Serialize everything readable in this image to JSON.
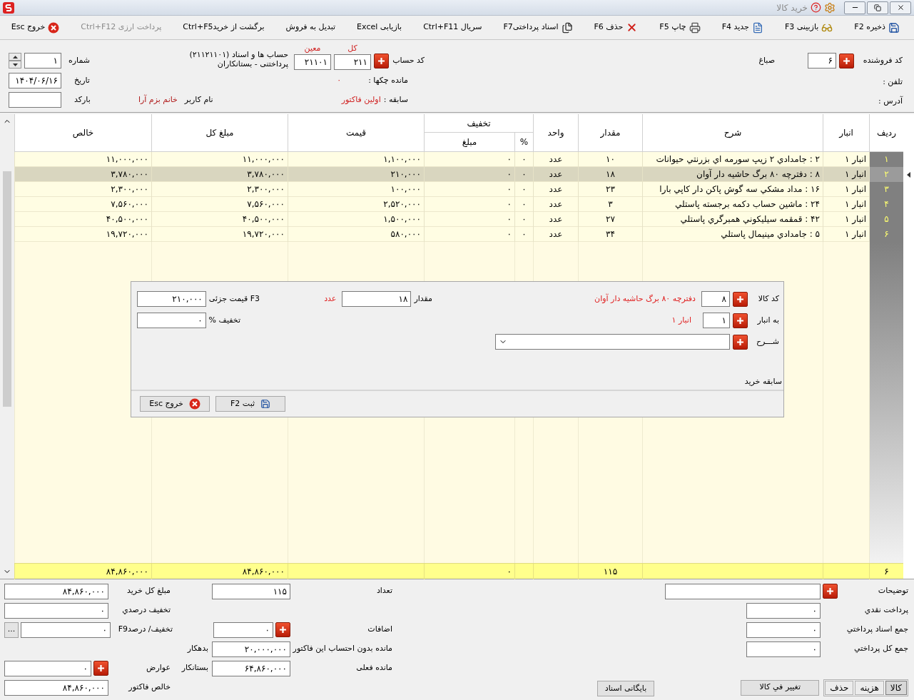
{
  "window": {
    "title": "خرید کالا"
  },
  "toolbar": [
    {
      "label": "ذخیره F2",
      "kind": "save",
      "disabled": false
    },
    {
      "label": "بازبینی F3",
      "kind": "review",
      "disabled": false
    },
    {
      "label": "جدید F4",
      "kind": "new",
      "disabled": false
    },
    {
      "label": "چاپ F5",
      "kind": "print",
      "disabled": false
    },
    {
      "label": "حذف F6",
      "kind": "delete",
      "disabled": false
    },
    {
      "label": "اسناد پرداختیF7",
      "kind": "docs",
      "disabled": false
    },
    {
      "label": "سریال Ctrl+F11",
      "kind": "text",
      "disabled": false
    },
    {
      "label": "بازیابی Excel",
      "kind": "text",
      "disabled": false
    },
    {
      "label": "تبدیل به فروش",
      "kind": "text",
      "disabled": false
    },
    {
      "label": "برگشت از خریدCtrl+F5",
      "kind": "text",
      "disabled": false
    },
    {
      "label": "پرداخت ارزی Ctrl+F12",
      "kind": "text",
      "disabled": true
    },
    {
      "label": "خروج Esc",
      "kind": "exit",
      "disabled": false
    }
  ],
  "header": {
    "vendor": {
      "label": "کد فروشنده",
      "value": "۶",
      "name": "صباغ"
    },
    "phone_label": "تلفن :",
    "address_label": "آدرس :",
    "account": {
      "label": "کد حساب",
      "total_label": "کل",
      "total": "۲۱۱",
      "sub_label": "معین",
      "sub": "۲۱۱۰۱",
      "title": "حساب ها و اسناد (۲۱۱۲۱۱۰۱)",
      "subtitle": "پرداختنی - بستانکاران"
    },
    "cheque_balance": {
      "label": "مانده چکها :",
      "value": "۰"
    },
    "history": {
      "label": "سابقه :",
      "value": "اولین فاکتور"
    },
    "user": {
      "label": "نام کاربر",
      "value": "خانم بزم آرا"
    },
    "number": {
      "label": "شماره",
      "value": "۱"
    },
    "date": {
      "label": "تاریخ",
      "value": "۱۴۰۴/۰۶/۱۶"
    },
    "barcode": {
      "label": "بارکد"
    }
  },
  "table": {
    "columns": [
      {
        "label": "ردیف"
      },
      {
        "label": "انبار"
      },
      {
        "label": "شرح"
      },
      {
        "label": "مقدار"
      },
      {
        "label": "واحد"
      },
      {
        "label": "تخفیف",
        "children": [
          {
            "label": "%"
          },
          {
            "label": "مبلغ"
          }
        ]
      },
      {
        "label": "قیمت"
      },
      {
        "label": "مبلغ کل"
      },
      {
        "label": "خالص"
      }
    ],
    "rows": [
      {
        "row": "۱",
        "warehouse": "انبار ۱",
        "description": "۲ : جامدادي ۲ زيپ سورمه اي بزرنتي حيوانات",
        "qty": "۱۰",
        "unit": "عدد",
        "percent": "۰",
        "discount": "۰",
        "price": "۱,۱۰۰,۰۰۰",
        "total": "۱۱,۰۰۰,۰۰۰",
        "net": "۱۱,۰۰۰,۰۰۰",
        "selected": false
      },
      {
        "row": "۲",
        "warehouse": "انبار ۱",
        "description": "۸ : دفترچه ۸۰ برگ حاشيه دار آوان",
        "qty": "۱۸",
        "unit": "عدد",
        "percent": "۰",
        "discount": "۰",
        "price": "۲۱۰,۰۰۰",
        "total": "۳,۷۸۰,۰۰۰",
        "net": "۳,۷۸۰,۰۰۰",
        "selected": true
      },
      {
        "row": "۳",
        "warehouse": "انبار ۱",
        "description": "۱۶ : مداد مشکي سه گوش پاکن دار کاپي بارا",
        "qty": "۲۳",
        "unit": "عدد",
        "percent": "۰",
        "discount": "۰",
        "price": "۱۰۰,۰۰۰",
        "total": "۲,۳۰۰,۰۰۰",
        "net": "۲,۳۰۰,۰۰۰",
        "selected": false
      },
      {
        "row": "۴",
        "warehouse": "انبار ۱",
        "description": "۲۴ : ماشين حساب دکمه برجسته پاستلي",
        "qty": "۳",
        "unit": "عدد",
        "percent": "۰",
        "discount": "۰",
        "price": "۲,۵۲۰,۰۰۰",
        "total": "۷,۵۶۰,۰۰۰",
        "net": "۷,۵۶۰,۰۰۰",
        "selected": false
      },
      {
        "row": "۵",
        "warehouse": "انبار ۱",
        "description": "۴۲ : قمقمه سيليکوني همبرگري پاستلي",
        "qty": "۲۷",
        "unit": "عدد",
        "percent": "۰",
        "discount": "۰",
        "price": "۱,۵۰۰,۰۰۰",
        "total": "۴۰,۵۰۰,۰۰۰",
        "net": "۴۰,۵۰۰,۰۰۰",
        "selected": false
      },
      {
        "row": "۶",
        "warehouse": "انبار ۱",
        "description": "۵ : جامدادي مينيمال پاستلي",
        "qty": "۳۴",
        "unit": "عدد",
        "percent": "۰",
        "discount": "۰",
        "price": "۵۸۰,۰۰۰",
        "total": "۱۹,۷۲۰,۰۰۰",
        "net": "۱۹,۷۲۰,۰۰۰",
        "selected": false
      }
    ],
    "totals": {
      "row": "۶",
      "qty": "۱۱۵",
      "discount": "۰",
      "total": "۸۴,۸۶۰,۰۰۰",
      "net": "۸۴,۸۶۰,۰۰۰"
    }
  },
  "item_dialog": {
    "code_label": "کد کالا",
    "code": "۸",
    "item_name": "دفترچه ۸۰ برگ حاشیه دار آوان",
    "qty_label": "مقدار",
    "qty": "۱۸",
    "unit": "عدد",
    "price_label": "F3 قیمت جزئی",
    "price": "۲۱۰,۰۰۰",
    "warehouse_label": "به انبار",
    "warehouse": "۱",
    "warehouse_name": "انبار ۱",
    "discount_label": "تخفیف %",
    "discount": "۰",
    "desc_label": "شـــرح",
    "history_label": "سابقه خرید",
    "buttons": [
      {
        "label": "ثبت F2",
        "kind": "save"
      },
      {
        "label": "خروج Esc",
        "kind": "exit"
      }
    ]
  },
  "summary": {
    "left": [
      {
        "label": "مبلغ کل خرید",
        "value": "۸۴,۸۶۰,۰۰۰",
        "kind": "field"
      },
      {
        "label": "تخفیف درصدي",
        "value": "۰",
        "kind": "field"
      },
      {
        "label": "تخفیف/ درصدF9",
        "value": "۰",
        "kind": "more",
        "button": "..."
      },
      {
        "label": "عوارض",
        "value": "۰",
        "kind": "plus"
      },
      {
        "label": "خالص فاکتور",
        "value": "۸۴,۸۶۰,۰۰۰",
        "kind": "field"
      }
    ],
    "middle": [
      {
        "label": "تعداد",
        "value": "۱۱۵",
        "kind": "field"
      },
      {
        "label": "اضافات",
        "value": "۰",
        "kind": "plus"
      },
      {
        "label": "مانده بدون احتساب این فاکتور",
        "value": "۲۰,۰۰۰,۰۰۰",
        "kind": "field",
        "suffix": "بدهکار"
      },
      {
        "label": "مانده فعلی",
        "value": "۶۴,۸۶۰,۰۰۰",
        "kind": "field",
        "suffix": "بستانکار"
      }
    ],
    "right": [
      {
        "label": "توضیحات",
        "kind": "note"
      },
      {
        "label": "پرداخت نقدي",
        "value": "۰",
        "kind": "field"
      },
      {
        "label": "جمع اسناد پرداختي",
        "value": "۰",
        "kind": "field"
      },
      {
        "label": "جمع کل پرداختي",
        "value": "۰",
        "kind": "field"
      }
    ],
    "tabs": [
      {
        "label": "کالا",
        "selected": true
      },
      {
        "label": "هزینه",
        "selected": false
      },
      {
        "label": "حذف",
        "selected": false
      }
    ],
    "change_price_button": "تغییر في کالا",
    "archive_button": "بایگانی اسناد"
  }
}
